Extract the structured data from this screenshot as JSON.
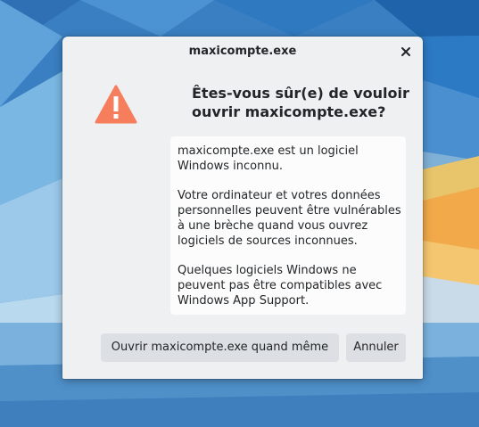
{
  "window": {
    "title": "maxicompte.exe"
  },
  "dialog": {
    "heading": "Êtes-vous sûr(e) de vouloir ouvrir maxicompte.exe?",
    "messages": [
      "maxicompte.exe est un logiciel Windows inconnu.",
      "Votre ordinateur et votres données personnelles peuvent être vulnérables à une brèche quand vous ouvrez logiciels de sources inconnues.",
      "Quelques logiciels Windows ne peuvent pas être compatibles avec Windows App Support."
    ],
    "buttons": {
      "open_label": "Ouvrir maxicompte.exe quand même",
      "cancel_label": "Annuler"
    }
  },
  "icons": {
    "close": "close-icon",
    "warning": "warning-icon"
  },
  "colors": {
    "warning": "#f67e5c",
    "dialog_bg": "#eff0f1",
    "button_bg": "#dcdfe3",
    "text": "#232629"
  }
}
